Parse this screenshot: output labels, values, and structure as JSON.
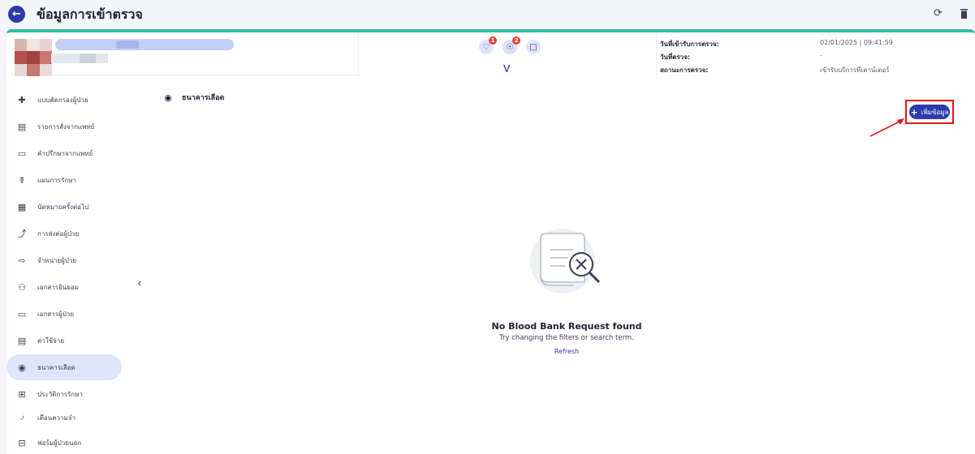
{
  "header": {
    "title": "ข้อมูลการเข้าตรวจ"
  },
  "patient_card": {
    "badges": [
      {
        "icon": "heart-monitor-icon",
        "count": "1"
      },
      {
        "icon": "virus-icon",
        "count": "2"
      },
      {
        "icon": "document-icon",
        "count": ""
      }
    ],
    "info": [
      {
        "label": "วันที่เข้ารับการตรวจ:",
        "value": "02/01/2025 | 09:41:59"
      },
      {
        "label": "วันที่ตรวจ:",
        "value": "-"
      },
      {
        "label": "สถานะการตรวจ:",
        "value": "เข้ารับบริการที่เคาน์เตอร์"
      }
    ]
  },
  "sidebar": {
    "items": [
      {
        "label": "แบบคัดกรองผู้ป่วย",
        "icon": "triage-icon"
      },
      {
        "label": "รายการสั่งจากแพทย์",
        "icon": "order-list-icon"
      },
      {
        "label": "คำปรึกษาจากแพทย์",
        "icon": "consult-icon"
      },
      {
        "label": "แผนการรักษา",
        "icon": "treatment-plan-icon"
      },
      {
        "label": "นัดหมายครั้งต่อไป",
        "icon": "calendar-icon"
      },
      {
        "label": "การส่งต่อผู้ป่วย",
        "icon": "referral-icon"
      },
      {
        "label": "จำหน่ายผู้ป่วย",
        "icon": "discharge-icon"
      },
      {
        "label": "เอกสารยินยอม",
        "icon": "consent-icon"
      },
      {
        "label": "เอกสารผู้ป่วย",
        "icon": "folder-icon"
      },
      {
        "label": "ค่าใช้จ่าย",
        "icon": "receipt-icon"
      },
      {
        "label": "ธนาคารเลือด",
        "icon": "blood-drop-icon"
      },
      {
        "label": "ประวัติการรักษา",
        "icon": "medical-history-icon"
      },
      {
        "label": "เตือนความจำ",
        "icon": "bell-icon"
      },
      {
        "label": "ฟอร์มผู้ป่วยนอก",
        "icon": "outpatient-form-icon"
      }
    ],
    "active_index": 10
  },
  "content": {
    "section_title": "ธนาคารเลือด",
    "add_button_label": "เพิ่มข้อมูล",
    "empty_title": "No Blood Bank Request found",
    "empty_subtitle": "Try changing the filters or search term.",
    "empty_refresh": "Refresh"
  },
  "colors": {
    "primary": "#2d3aa8",
    "accent_teal": "#2fbfa7",
    "active_item_bg": "#dde4fb",
    "highlight_red": "#e3141b",
    "badge_red": "#e8433a"
  }
}
